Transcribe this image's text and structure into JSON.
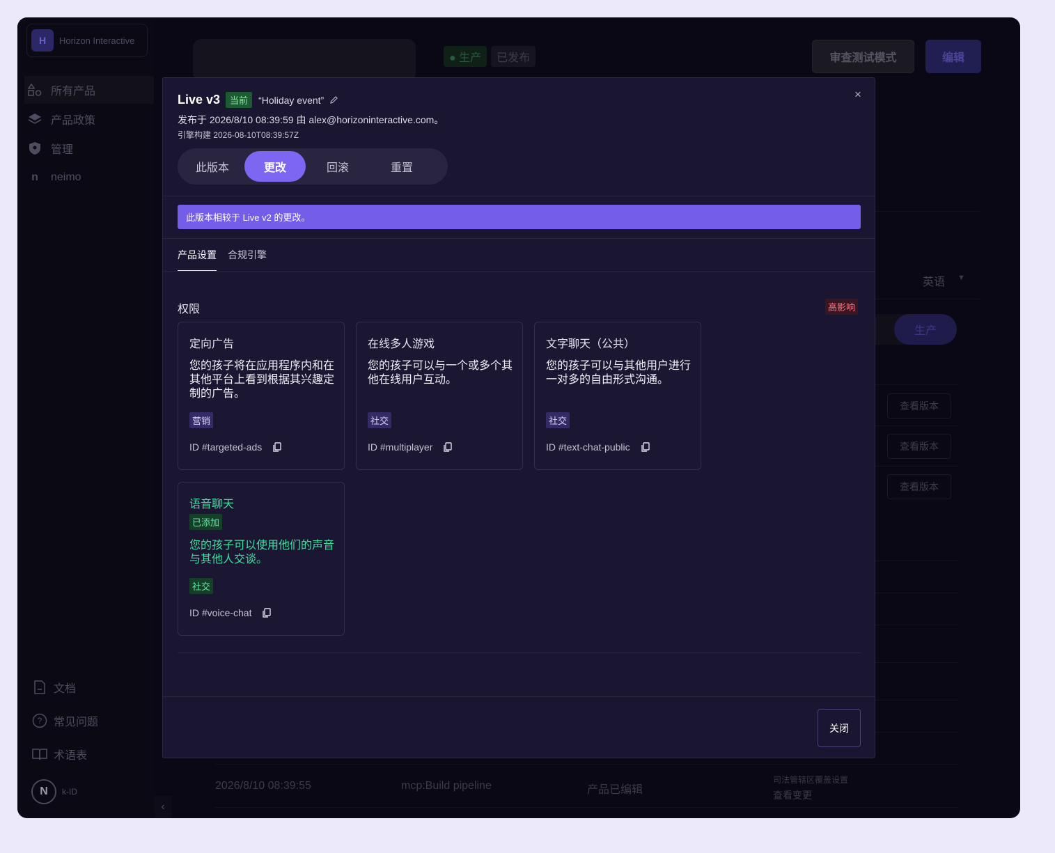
{
  "sidebar": {
    "org_name": "Horizon Interactive",
    "org_initial": "H",
    "items": [
      {
        "label": "所有产品",
        "icon": "products-icon"
      },
      {
        "label": "产品政策",
        "icon": "layers-icon"
      },
      {
        "label": "管理",
        "icon": "shield-icon"
      },
      {
        "label": "neimo",
        "icon": "n-icon"
      }
    ],
    "footer": [
      {
        "label": "文档",
        "icon": "document-icon"
      },
      {
        "label": "常见问题",
        "icon": "help-icon"
      },
      {
        "label": "术语表",
        "icon": "book-icon"
      }
    ],
    "brand_initial": "N",
    "brand_label": "k-ID"
  },
  "background": {
    "status_prod": "● 生产",
    "status_published": "已发布",
    "review_button": "审查测试模式",
    "edit_button": "编辑",
    "language": "英语",
    "prod_pill": "生产",
    "view_version": "查看版本",
    "row": {
      "time": "2026/8/10 08:39:55",
      "actor": "mcp:Build pipeline",
      "event": "产品已编辑",
      "detail": "司法管辖区覆盖设置",
      "link": "查看变更"
    }
  },
  "modal": {
    "version": "Live v3",
    "current_badge": "当前",
    "name": "“Holiday event”",
    "published": "发布于 2026/8/10 08:39:59 由 alex@horizoninteractive.com。",
    "engine_build": "引擎构建 2026-08-10T08:39:57Z",
    "segments": [
      "此版本",
      "更改",
      "回滚",
      "重置"
    ],
    "active_segment": "更改",
    "info": "此版本相较于 Live v2 的更改。",
    "tabs": [
      "产品设置",
      "合规引擎"
    ],
    "section_title": "权限",
    "impact_badge": "高影响",
    "cards": [
      {
        "title": "定向广告",
        "desc": "您的孩子将在应用程序内和在其他平台上看到根据其兴趣定制的广告。",
        "tag": "营销",
        "id": "ID #targeted-ads"
      },
      {
        "title": "在线多人游戏",
        "desc": "您的孩子可以与一个或多个其他在线用户互动。",
        "tag": "社交",
        "id": "ID #multiplayer"
      },
      {
        "title": "文字聊天（公共）",
        "desc": "您的孩子可以与其他用户进行一对多的自由形式沟通。",
        "tag": "社交",
        "id": "ID #text-chat-public"
      },
      {
        "title": "语音聊天",
        "added": "已添加",
        "desc": "您的孩子可以使用他们的声音与其他人交谈。",
        "tag": "社交",
        "id": "ID #voice-chat"
      }
    ],
    "close_button": "关闭"
  },
  "colors": {
    "accent": "#7d66f2",
    "info_bar": "#735de9",
    "added_green": "#3ee0a0",
    "impact_red": "#ef7b8a"
  }
}
